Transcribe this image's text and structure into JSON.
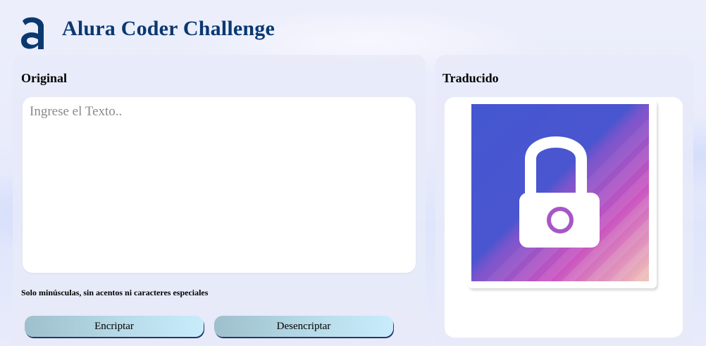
{
  "header": {
    "title": "Alura Coder Challenge",
    "logo_icon": "alura-a-logo-icon"
  },
  "input_panel": {
    "label": "Original",
    "placeholder": "Ingrese el Texto..",
    "value": "",
    "hint": "Solo minúsculas, sin acentos ni caracteres especiales"
  },
  "buttons": {
    "encrypt_label": "Encriptar",
    "decrypt_label": "Desencriptar"
  },
  "output_panel": {
    "label": "Traducido",
    "illustration_icon": "padlock-icon"
  },
  "colors": {
    "brand": "#0a3871",
    "illustration_start": "#4457d0",
    "illustration_mid": "#c853c0",
    "illustration_end": "#f2c6b7"
  }
}
